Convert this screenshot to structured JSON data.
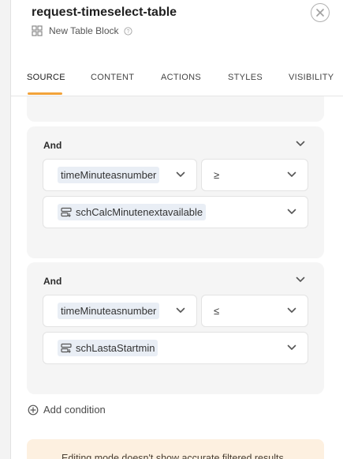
{
  "header": {
    "title": "request-timeselect-table",
    "block_type": "New Table Block"
  },
  "tabs": [
    {
      "label": "SOURCE",
      "active": true
    },
    {
      "label": "CONTENT",
      "active": false
    },
    {
      "label": "ACTIONS",
      "active": false
    },
    {
      "label": "STYLES",
      "active": false
    },
    {
      "label": "VISIBILITY",
      "active": false
    }
  ],
  "filters": [
    {
      "conjunction": "And",
      "field": "timeMinuteasnumber",
      "operator": "≥",
      "value": "schCalcMinutenextavailable"
    },
    {
      "conjunction": "And",
      "field": "timeMinuteasnumber",
      "operator": "≤",
      "value": "schLastaStartmin"
    }
  ],
  "add_condition_label": "Add condition",
  "notice_text": "Editing mode doesn't show accurate filtered results",
  "colors": {
    "accent": "#f2a33a",
    "card_bg": "#f5f5f5",
    "pill_bg": "#e9eef5",
    "notice_bg": "#fdf0e0"
  },
  "icons": {
    "close": "close-icon",
    "block_type": "table-grid-icon",
    "help": "help-icon",
    "chevron": "chevron-down-icon",
    "value_source": "database-icon",
    "add": "plus-circle-icon"
  }
}
